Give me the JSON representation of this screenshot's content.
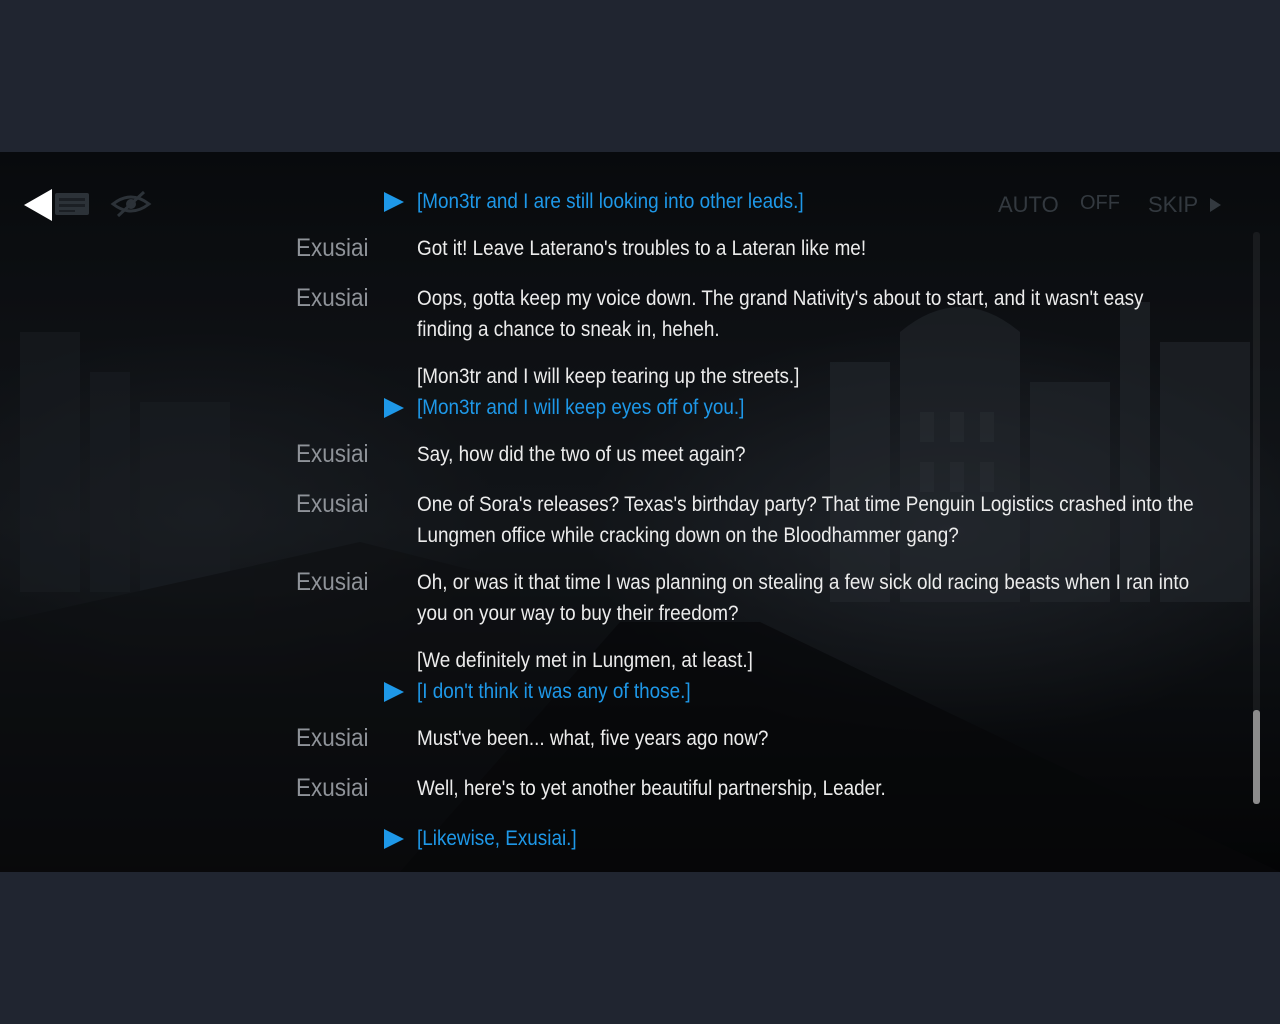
{
  "controls": {
    "auto_label": "AUTO",
    "auto_state": "OFF",
    "skip_label": "SKIP"
  },
  "log": {
    "choice1": "[Mon3tr and I are still looking into other leads.]",
    "e1": {
      "speaker": "Exusiai",
      "text": "Got it! Leave Laterano's troubles to a Lateran like me!"
    },
    "e2": {
      "speaker": "Exusiai",
      "line1": "Oops, gotta keep my voice down. The grand Nativity's about to start, and it wasn't easy",
      "line2": "finding a chance to sneak in, heheh."
    },
    "choice2": {
      "option": "[Mon3tr and I will keep tearing up the streets.]",
      "selected": "[Mon3tr and I will keep eyes off of you.]"
    },
    "e3": {
      "speaker": "Exusiai",
      "text": "Say, how did the two of us meet again?"
    },
    "e4": {
      "speaker": "Exusiai",
      "line1": "One of Sora's releases? Texas's birthday party? That time Penguin Logistics crashed into the",
      "line2": "Lungmen office while cracking down on the Bloodhammer gang?"
    },
    "e5": {
      "speaker": "Exusiai",
      "line1": "Oh, or was it that time I was planning on stealing a few sick old racing beasts when I ran into",
      "line2": "you on your way to buy their freedom?"
    },
    "choice3": {
      "option": "[We definitely met in Lungmen, at least.]",
      "selected": "[I don't think it was any of those.]"
    },
    "e6": {
      "speaker": "Exusiai",
      "text": "Must've been... what, five years ago now?"
    },
    "e7": {
      "speaker": "Exusiai",
      "text": "Well, here's to yet another beautiful partnership, Leader."
    },
    "choice4": "[Likewise, Exusiai.]"
  },
  "colors": {
    "choice_blue": "#1e98e8",
    "text_white": "#ececec",
    "speaker_gray": "#8f9399",
    "letterbox": "#202530"
  },
  "icons": [
    "back-arrow-icon",
    "log-icon",
    "hide-ui-icon",
    "skip-arrow-icon",
    "selected-choice-marker-icon"
  ],
  "scroll_position": 0.84
}
